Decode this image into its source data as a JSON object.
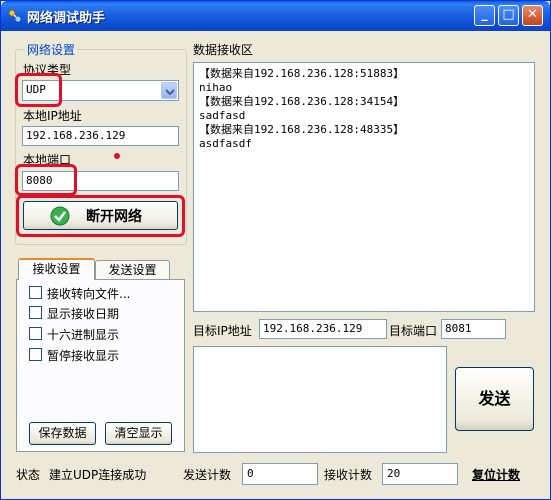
{
  "window": {
    "title": "网络调试助手",
    "minimize": "_",
    "maximize": "□",
    "close": "✕"
  },
  "network_settings": {
    "caption": "网络设置",
    "protocol_label": "协议类型",
    "protocol_value": "UDP",
    "local_ip_label": "本地IP地址",
    "local_ip_value": "192.168.236.129",
    "local_port_label": "本地端口",
    "local_port_value": "8080",
    "connect_button": "断开网络"
  },
  "tabs": [
    {
      "label": "接收设置",
      "active": true
    },
    {
      "label": "发送设置",
      "active": false
    }
  ],
  "receive_options": [
    {
      "label": "接收转向文件...",
      "checked": false
    },
    {
      "label": "显示接收日期",
      "checked": false
    },
    {
      "label": "十六进制显示",
      "checked": false
    },
    {
      "label": "暂停接收显示",
      "checked": false
    }
  ],
  "panel_buttons": {
    "save": "保存数据",
    "clear": "清空显示"
  },
  "receive_area": {
    "caption": "数据接收区",
    "lines": [
      "【数据来自192.168.236.128:51883】",
      "nihao",
      "【数据来自192.168.236.128:34154】",
      "sadfasd",
      "【数据来自192.168.236.128:48335】",
      "asdfasdf"
    ]
  },
  "target": {
    "ip_label": "目标IP地址",
    "ip_value": "192.168.236.129",
    "port_label": "目标端口",
    "port_value": "8081"
  },
  "send_button": "发送",
  "status_bar": {
    "status_label": "状态",
    "status_text": "建立UDP连接成功",
    "send_count_label": "发送计数",
    "send_count": "0",
    "recv_count_label": "接收计数",
    "recv_count": "20",
    "reset_label": "复位计数"
  },
  "colors": {
    "title_bar": "#0a5fdf",
    "highlight": "#e0102a",
    "accent_tab": "#e68b2c",
    "group_caption": "#0046d5"
  }
}
